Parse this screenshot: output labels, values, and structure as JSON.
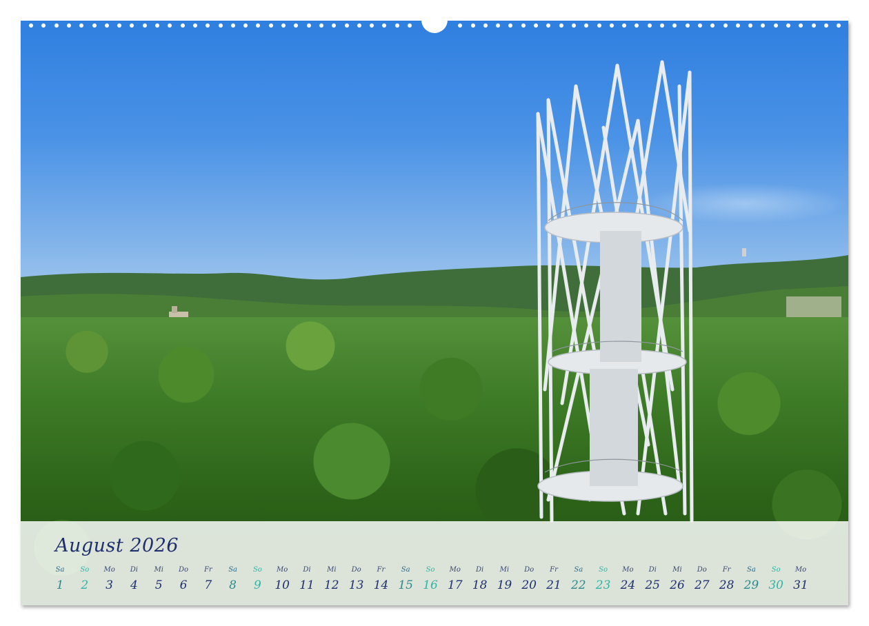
{
  "calendar": {
    "month_title": "August 2026",
    "days": [
      {
        "weekday": "Sa",
        "day": "1",
        "kind": "sat"
      },
      {
        "weekday": "So",
        "day": "2",
        "kind": "sun"
      },
      {
        "weekday": "Mo",
        "day": "3",
        "kind": "week"
      },
      {
        "weekday": "Di",
        "day": "4",
        "kind": "week"
      },
      {
        "weekday": "Mi",
        "day": "5",
        "kind": "week"
      },
      {
        "weekday": "Do",
        "day": "6",
        "kind": "week"
      },
      {
        "weekday": "Fr",
        "day": "7",
        "kind": "week"
      },
      {
        "weekday": "Sa",
        "day": "8",
        "kind": "sat"
      },
      {
        "weekday": "So",
        "day": "9",
        "kind": "sun"
      },
      {
        "weekday": "Mo",
        "day": "10",
        "kind": "week"
      },
      {
        "weekday": "Di",
        "day": "11",
        "kind": "week"
      },
      {
        "weekday": "Mi",
        "day": "12",
        "kind": "week"
      },
      {
        "weekday": "Do",
        "day": "13",
        "kind": "week"
      },
      {
        "weekday": "Fr",
        "day": "14",
        "kind": "week"
      },
      {
        "weekday": "Sa",
        "day": "15",
        "kind": "sat"
      },
      {
        "weekday": "So",
        "day": "16",
        "kind": "sun"
      },
      {
        "weekday": "Mo",
        "day": "17",
        "kind": "week"
      },
      {
        "weekday": "Di",
        "day": "18",
        "kind": "week"
      },
      {
        "weekday": "Mi",
        "day": "19",
        "kind": "week"
      },
      {
        "weekday": "Do",
        "day": "20",
        "kind": "week"
      },
      {
        "weekday": "Fr",
        "day": "21",
        "kind": "week"
      },
      {
        "weekday": "Sa",
        "day": "22",
        "kind": "sat"
      },
      {
        "weekday": "So",
        "day": "23",
        "kind": "sun"
      },
      {
        "weekday": "Mo",
        "day": "24",
        "kind": "week"
      },
      {
        "weekday": "Di",
        "day": "25",
        "kind": "week"
      },
      {
        "weekday": "Mi",
        "day": "26",
        "kind": "week"
      },
      {
        "weekday": "Do",
        "day": "27",
        "kind": "week"
      },
      {
        "weekday": "Fr",
        "day": "28",
        "kind": "week"
      },
      {
        "weekday": "Sa",
        "day": "29",
        "kind": "sat"
      },
      {
        "weekday": "So",
        "day": "30",
        "kind": "sun"
      },
      {
        "weekday": "Mo",
        "day": "31",
        "kind": "week"
      }
    ]
  },
  "colors": {
    "text_dark_blue": "#1f2f6e",
    "sunday_teal": "#2fb5a3",
    "sky_blue": "#2f7fe0",
    "forest_green": "#3d7a26",
    "tower_white": "#e8ecef"
  },
  "photo": {
    "subject": "lattice observation tower above forest"
  }
}
